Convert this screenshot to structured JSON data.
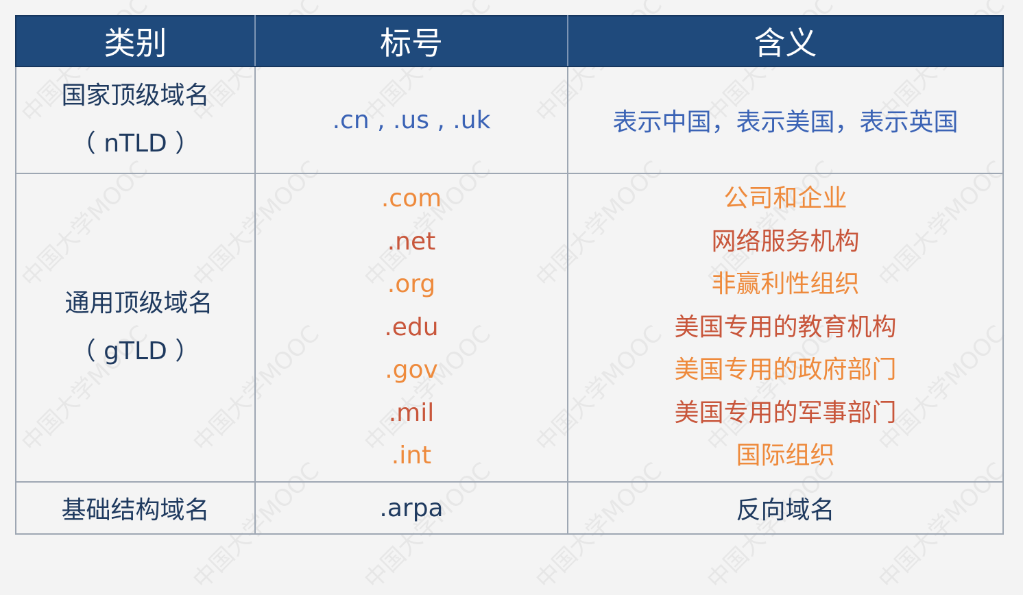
{
  "header": {
    "col1": "类别",
    "col2": "标号",
    "col3": "含义"
  },
  "rows": {
    "ntld": {
      "category_line1": "国家顶级域名",
      "category_line2": "（ nTLD ）",
      "codes": ".cn , .us , .uk",
      "meaning": "表示中国，表示美国，表示英国"
    },
    "gtld": {
      "category_line1": "通用顶级域名",
      "category_line2": "（ gTLD ）",
      "items": [
        {
          "code": ".com",
          "meaning": "公司和企业"
        },
        {
          "code": ".net",
          "meaning": "网络服务机构"
        },
        {
          "code": ".org",
          "meaning": "非赢利性组织"
        },
        {
          "code": ".edu",
          "meaning": "美国专用的教育机构"
        },
        {
          "code": ".gov",
          "meaning": "美国专用的政府部门"
        },
        {
          "code": ".mil",
          "meaning": "美国专用的军事部门"
        },
        {
          "code": ".int",
          "meaning": "国际组织"
        }
      ]
    },
    "arpa": {
      "category": "基础结构域名",
      "code": ".arpa",
      "meaning": "反向域名"
    }
  },
  "watermark_text": "中国大学MOOC",
  "colors": {
    "header_bg": "#1f4a7c",
    "blue_text": "#3b63b5",
    "orange_text": "#ee8a3c",
    "rust_text": "#c8563b",
    "dark_text": "#1f3a5f"
  }
}
